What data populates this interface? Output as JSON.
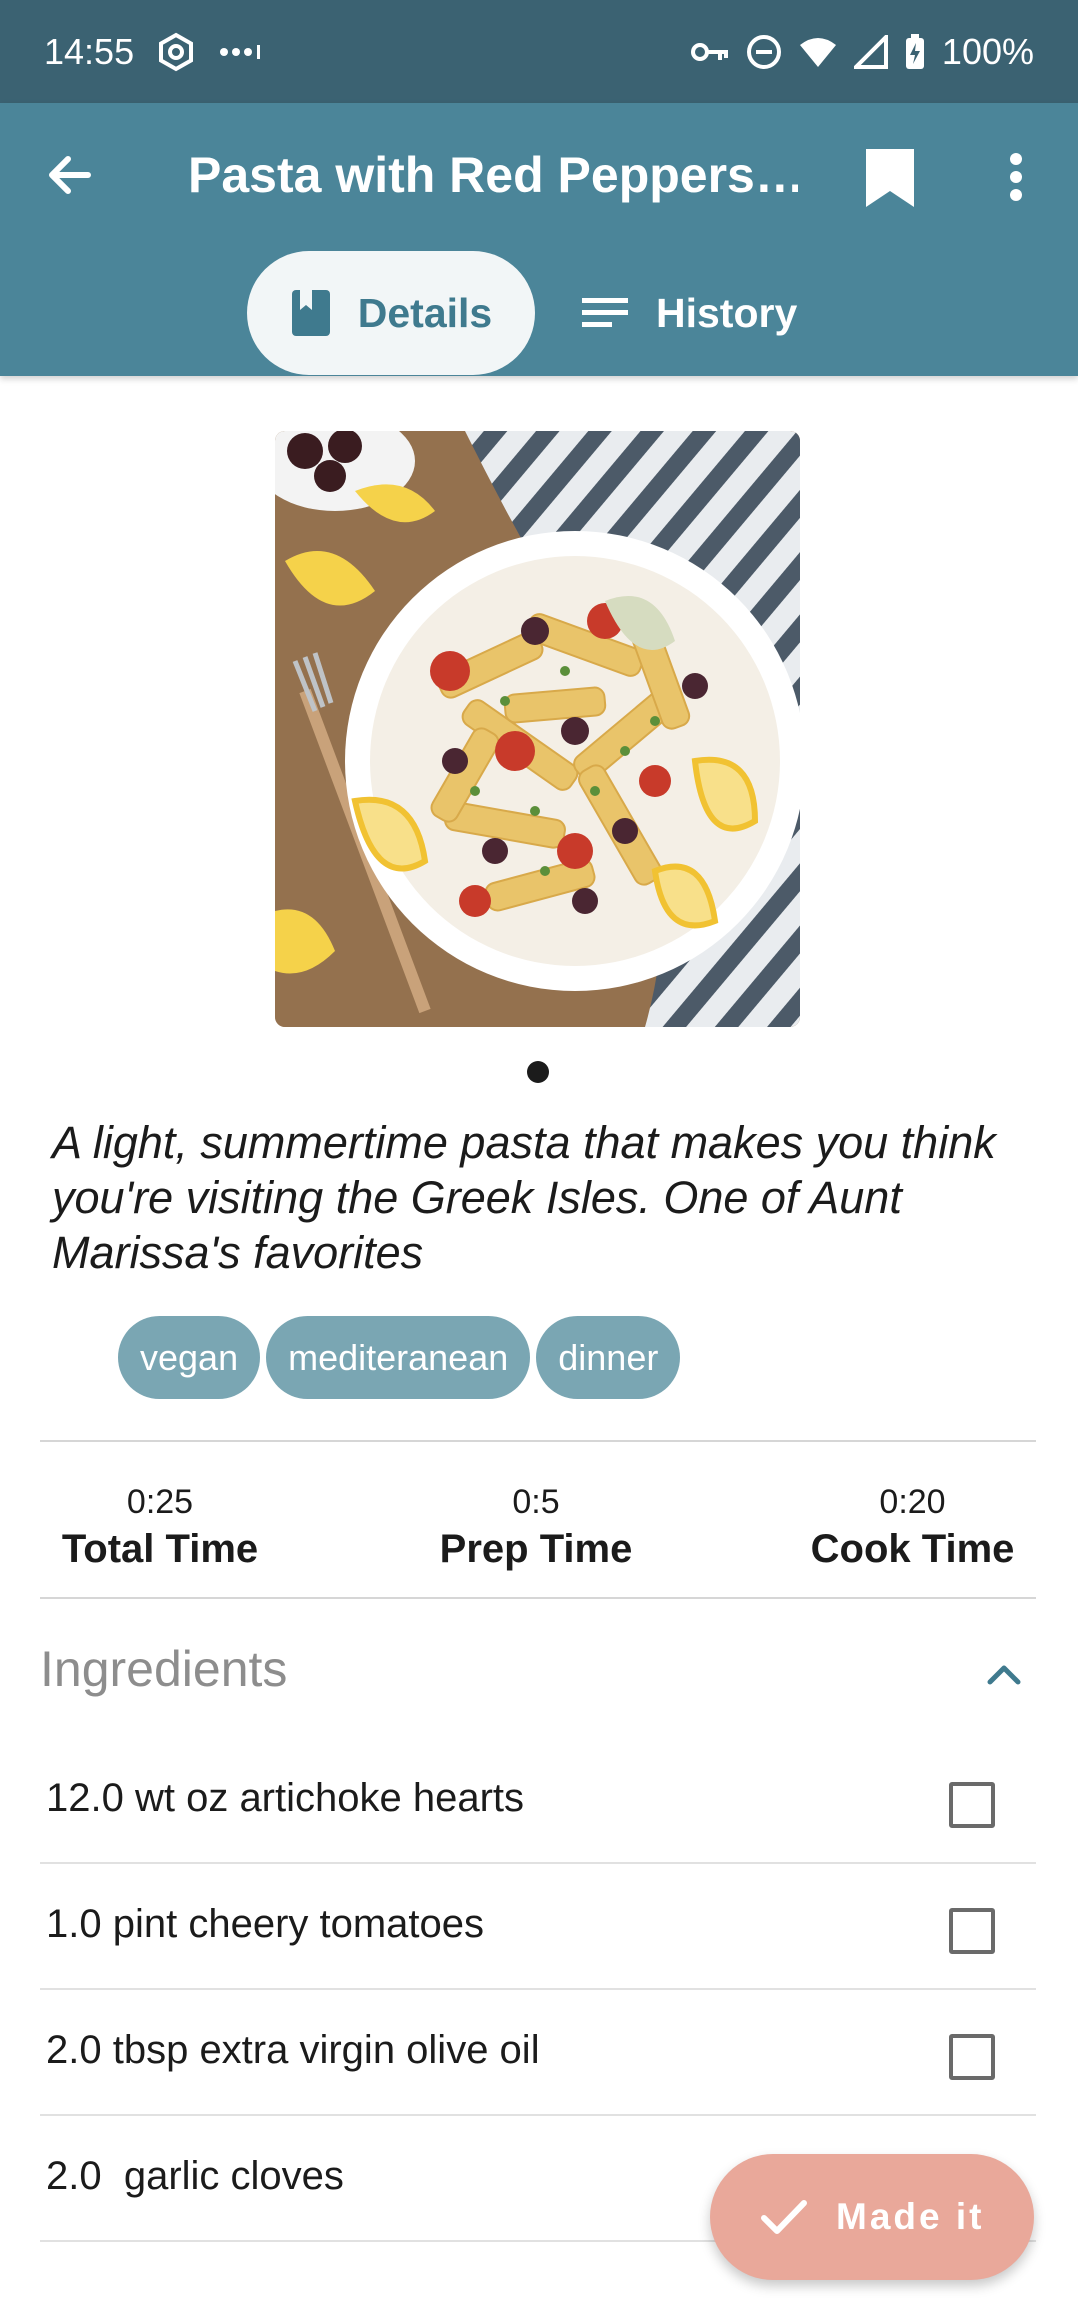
{
  "status_bar": {
    "time": "14:55",
    "battery": "100%"
  },
  "app_bar": {
    "title": "Pasta with Red Peppers…",
    "tabs": [
      {
        "label": "Details",
        "icon": "book-icon",
        "selected": true
      },
      {
        "label": "History",
        "icon": "list-icon",
        "selected": false
      }
    ]
  },
  "recipe": {
    "description": "A light, summertime pasta that makes you think you're visiting the Greek Isles. One of Aunt Marissa's favorites",
    "tags": [
      "vegan",
      "mediteranean",
      "dinner"
    ],
    "times": [
      {
        "value": "0:25",
        "label": "Total Time"
      },
      {
        "value": "0:5",
        "label": "Prep Time"
      },
      {
        "value": "0:20",
        "label": "Cook Time"
      }
    ]
  },
  "ingredients": {
    "header": "Ingredients",
    "items": [
      {
        "text": "12.0 wt oz artichoke hearts",
        "checked": false
      },
      {
        "text": "1.0 pint cheery tomatoes",
        "checked": false
      },
      {
        "text": "2.0 tbsp extra virgin olive oil",
        "checked": false
      },
      {
        "text": "2.0  garlic cloves",
        "checked": false
      }
    ]
  },
  "fab": {
    "label": "Made it",
    "color": "#e9a89a"
  },
  "colors": {
    "status_bar": "#3b6272",
    "app_bar": "#4b8599",
    "tag": "#7aa6b3",
    "accent": "#3f7a8e"
  }
}
